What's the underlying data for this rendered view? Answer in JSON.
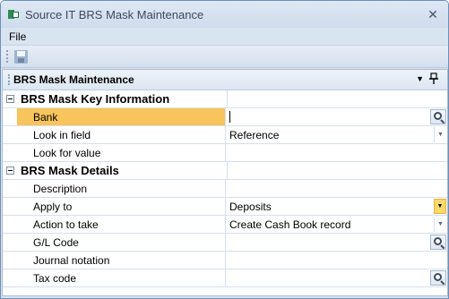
{
  "window": {
    "title": "Source IT BRS Mask Maintenance",
    "icon": "app-icon",
    "close_glyph": "✕"
  },
  "menu": {
    "items": [
      "File"
    ]
  },
  "toolbar": {
    "save_icon": "save-icon"
  },
  "panel": {
    "title": "BRS Mask Maintenance",
    "dropdown_glyph": "▼",
    "pin_glyph": "📌"
  },
  "grid": {
    "categories": [
      {
        "label": "BRS Mask Key Information",
        "rows": [
          {
            "name": "Bank",
            "value": "",
            "editor": "lookup",
            "selected": true
          },
          {
            "name": "Look in field",
            "value": "Reference",
            "editor": "dropdown"
          },
          {
            "name": "Look for value",
            "value": "",
            "editor": "text"
          }
        ]
      },
      {
        "label": "BRS Mask Details",
        "rows": [
          {
            "name": "Description",
            "value": "",
            "editor": "text"
          },
          {
            "name": "Apply to",
            "value": "Deposits",
            "editor": "dropdown-active"
          },
          {
            "name": "Action to take",
            "value": "Create Cash Book record",
            "editor": "dropdown"
          },
          {
            "name": "G/L Code",
            "value": "",
            "editor": "lookup"
          },
          {
            "name": "Journal notation",
            "value": "",
            "editor": "text"
          },
          {
            "name": "Tax code",
            "value": "",
            "editor": "lookup"
          }
        ]
      }
    ]
  },
  "colors": {
    "selected_row": "#f8c45c",
    "window_border": "#6b8fb8",
    "chrome": "#d9e4f1"
  }
}
